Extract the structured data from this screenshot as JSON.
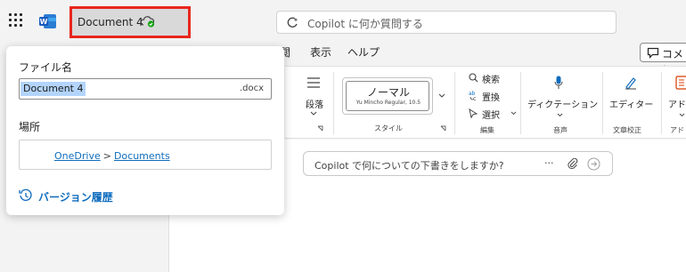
{
  "header": {
    "doc_title": "Document 4",
    "search_placeholder": "Copilot に何か質問する"
  },
  "menu": {
    "items": [
      "閲",
      "表示",
      "ヘルプ"
    ],
    "comment_label": "コメン"
  },
  "ribbon": {
    "paragraph_label": "段落",
    "style_label": "スタイル",
    "style_name": "ノーマル",
    "style_font": "Yu Mincho Regular, 10.5",
    "find_label": "検索",
    "replace_label": "置換",
    "select_label": "選択",
    "edit_label": "編集",
    "dictation_label": "ディクテーション",
    "voice_label": "音声",
    "editor_label": "エディター",
    "proofing_label": "文章校正",
    "addins_label": "アド",
    "addins_group_label": "アド"
  },
  "copilot": {
    "prompt_text": "Copilot で何についての下書きをしますか?",
    "more_label": "···"
  },
  "popup": {
    "filename_label": "ファイル名",
    "filename_value": "Document 4",
    "extension": ".docx",
    "location_label": "場所",
    "location_path": [
      "OneDrive",
      "Documents"
    ],
    "path_separator": ">",
    "version_history_label": "バージョン履歴"
  },
  "colors": {
    "highlight_border": "#e8261d",
    "link": "#0f6cbd",
    "selection": "#b3d4fc",
    "sync_green": "#13a10e"
  }
}
